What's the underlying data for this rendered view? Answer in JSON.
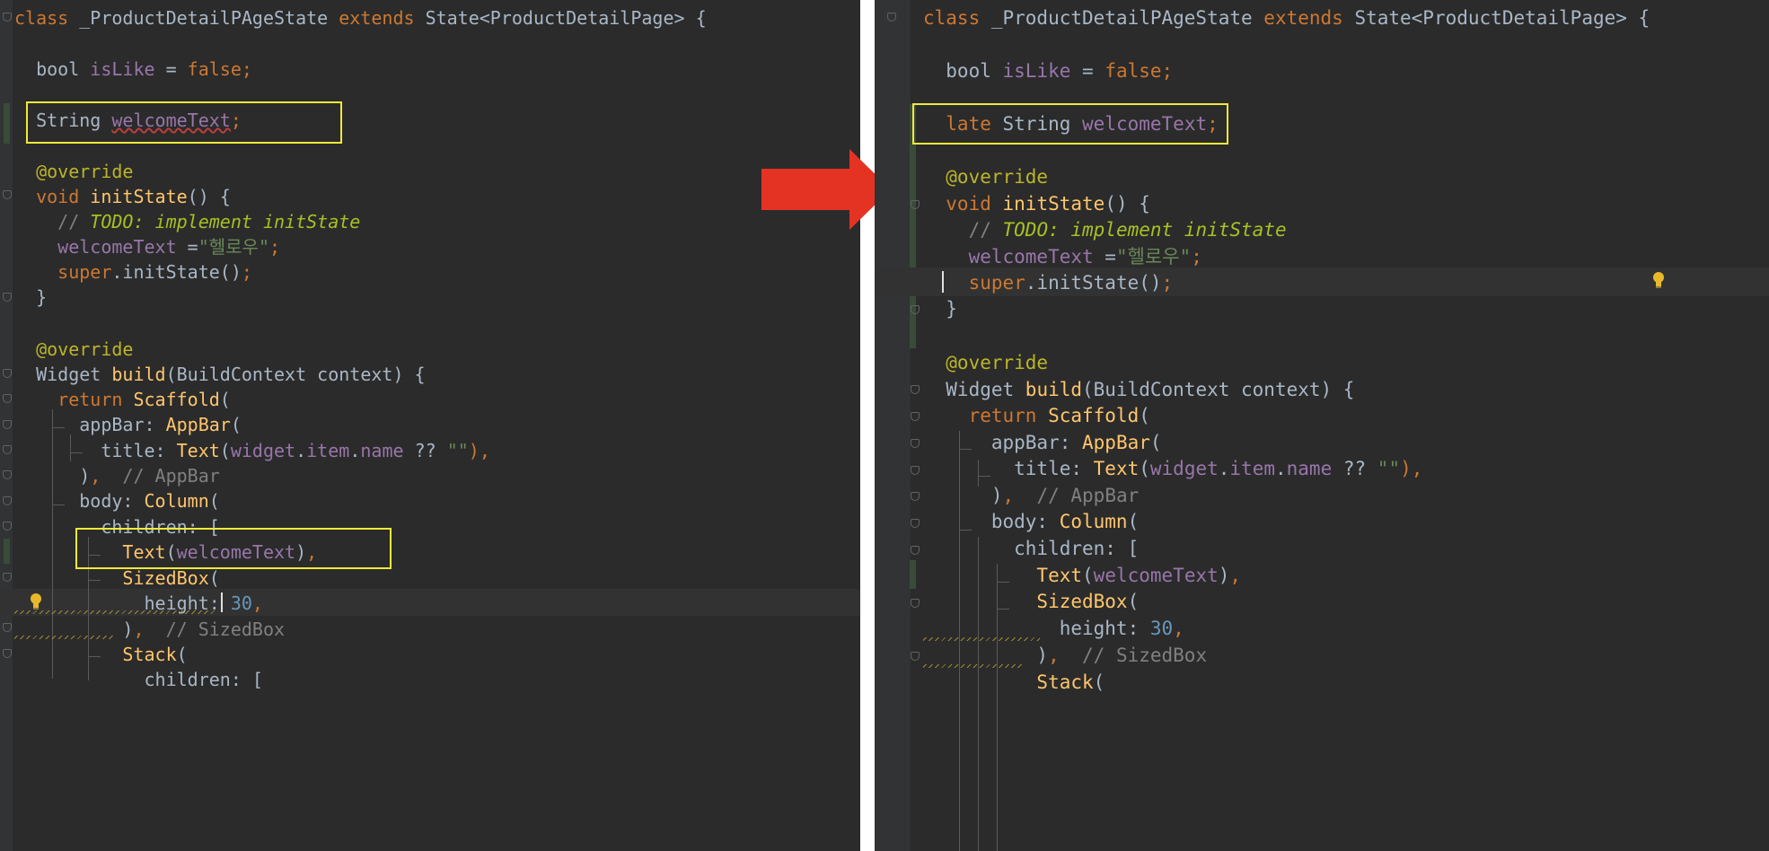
{
  "left": {
    "lines": [
      [
        {
          "t": "class ",
          "c": "kw"
        },
        {
          "t": "_ProductDetailPAgeState ",
          "c": "class"
        },
        {
          "t": "extends ",
          "c": "kw"
        },
        {
          "t": "State<ProductDetailPage> {",
          "c": ""
        }
      ],
      [
        {
          "t": "  bool ",
          "c": ""
        },
        {
          "t": "isLike",
          "c": "field"
        },
        {
          "t": " = ",
          "c": ""
        },
        {
          "t": "false",
          "c": "kw"
        },
        {
          "t": ";",
          "c": "kw"
        }
      ],
      [
        {
          "t": "  String ",
          "c": ""
        },
        {
          "t": "welcomeText",
          "c": "err"
        },
        {
          "t": ";",
          "c": "kw"
        }
      ],
      [
        {
          "t": "  @override",
          "c": "ann"
        }
      ],
      [
        {
          "t": "  void ",
          "c": "kw"
        },
        {
          "t": "initState",
          "c": "method"
        },
        {
          "t": "() {",
          "c": ""
        }
      ],
      [
        {
          "t": "    // ",
          "c": "comment"
        },
        {
          "t": "TODO: implement initState",
          "c": "todo"
        }
      ],
      [
        {
          "t": "    welcomeText",
          "c": "field"
        },
        {
          "t": " =",
          "c": ""
        },
        {
          "t": "\"헬로우\"",
          "c": "str"
        },
        {
          "t": ";",
          "c": "kw"
        }
      ],
      [
        {
          "t": "    super",
          "c": "kw"
        },
        {
          "t": ".initState()",
          "c": ""
        },
        {
          "t": ";",
          "c": "kw"
        }
      ],
      [
        {
          "t": "  }",
          "c": ""
        }
      ],
      [
        {
          "t": "  @override",
          "c": "ann"
        }
      ],
      [
        {
          "t": "  Widget ",
          "c": ""
        },
        {
          "t": "build",
          "c": "method"
        },
        {
          "t": "(BuildContext context) {",
          "c": ""
        }
      ],
      [
        {
          "t": "    return ",
          "c": "kw"
        },
        {
          "t": "Scaffold",
          "c": "method"
        },
        {
          "t": "(",
          "c": ""
        }
      ],
      [
        {
          "t": "      appBar: ",
          "c": ""
        },
        {
          "t": "AppBar",
          "c": "method"
        },
        {
          "t": "(",
          "c": ""
        }
      ],
      [
        {
          "t": "        title: ",
          "c": ""
        },
        {
          "t": "Text",
          "c": "method"
        },
        {
          "t": "(",
          "c": ""
        },
        {
          "t": "widget",
          "c": "field"
        },
        {
          "t": ".",
          "c": ""
        },
        {
          "t": "item",
          "c": "field"
        },
        {
          "t": ".",
          "c": ""
        },
        {
          "t": "name",
          "c": "field"
        },
        {
          "t": " ?? ",
          "c": ""
        },
        {
          "t": "\"\"",
          "c": "str"
        },
        {
          "t": "),",
          "c": "kw"
        }
      ],
      [
        {
          "t": "      )",
          "c": ""
        },
        {
          "t": ",",
          "c": "kw"
        },
        {
          "t": "  // AppBar",
          "c": "comment"
        }
      ],
      [
        {
          "t": "      body: ",
          "c": ""
        },
        {
          "t": "Column",
          "c": "method"
        },
        {
          "t": "(",
          "c": ""
        }
      ],
      [
        {
          "t": "        children: [",
          "c": ""
        }
      ],
      [
        {
          "t": "          Text",
          "c": "method"
        },
        {
          "t": "(",
          "c": ""
        },
        {
          "t": "welcomeText",
          "c": "field"
        },
        {
          "t": ")",
          "c": ""
        },
        {
          "t": ",",
          "c": "kw"
        }
      ],
      [
        {
          "t": "          SizedBox",
          "c": "method"
        },
        {
          "t": "(",
          "c": ""
        }
      ],
      [
        {
          "t": "            height: ",
          "c": ""
        },
        {
          "t": "30",
          "c": "num"
        },
        {
          "t": ",",
          "c": "kw"
        }
      ],
      [
        {
          "t": "          )",
          "c": ""
        },
        {
          "t": ",",
          "c": "kw"
        },
        {
          "t": "  // SizedBox",
          "c": "comment"
        }
      ],
      [
        {
          "t": "          Stack",
          "c": "method"
        },
        {
          "t": "(",
          "c": ""
        }
      ],
      [
        {
          "t": "            children: [",
          "c": ""
        }
      ]
    ]
  },
  "right": {
    "lines": [
      [
        {
          "t": "class ",
          "c": "kw"
        },
        {
          "t": "_ProductDetailPAgeState ",
          "c": "class"
        },
        {
          "t": "extends ",
          "c": "kw"
        },
        {
          "t": "State<ProductDetailPage> {",
          "c": ""
        }
      ],
      [
        {
          "t": "  bool ",
          "c": ""
        },
        {
          "t": "isLike",
          "c": "field"
        },
        {
          "t": " = ",
          "c": ""
        },
        {
          "t": "false",
          "c": "kw"
        },
        {
          "t": ";",
          "c": "kw"
        }
      ],
      [
        {
          "t": "  late ",
          "c": "kw"
        },
        {
          "t": "String ",
          "c": ""
        },
        {
          "t": "welcomeText",
          "c": "field"
        },
        {
          "t": ";",
          "c": "kw"
        }
      ],
      [
        {
          "t": "  @override",
          "c": "ann"
        }
      ],
      [
        {
          "t": "  void ",
          "c": "kw"
        },
        {
          "t": "initState",
          "c": "method"
        },
        {
          "t": "() {",
          "c": ""
        }
      ],
      [
        {
          "t": "    // ",
          "c": "comment"
        },
        {
          "t": "TODO: implement initState",
          "c": "todo"
        }
      ],
      [
        {
          "t": "    welcomeText",
          "c": "field"
        },
        {
          "t": " =",
          "c": ""
        },
        {
          "t": "\"헬로우\"",
          "c": "str"
        },
        {
          "t": ";",
          "c": "kw"
        }
      ],
      [
        {
          "t": "    super",
          "c": "kw"
        },
        {
          "t": ".initState()",
          "c": ""
        },
        {
          "t": ";",
          "c": "kw"
        }
      ],
      [
        {
          "t": "  }",
          "c": ""
        }
      ],
      [
        {
          "t": "  @override",
          "c": "ann"
        }
      ],
      [
        {
          "t": "  Widget ",
          "c": ""
        },
        {
          "t": "build",
          "c": "method"
        },
        {
          "t": "(BuildContext context) {",
          "c": ""
        }
      ],
      [
        {
          "t": "    return ",
          "c": "kw"
        },
        {
          "t": "Scaffold",
          "c": "method"
        },
        {
          "t": "(",
          "c": ""
        }
      ],
      [
        {
          "t": "      appBar: ",
          "c": ""
        },
        {
          "t": "AppBar",
          "c": "method"
        },
        {
          "t": "(",
          "c": ""
        }
      ],
      [
        {
          "t": "        title: ",
          "c": ""
        },
        {
          "t": "Text",
          "c": "method"
        },
        {
          "t": "(",
          "c": ""
        },
        {
          "t": "widget",
          "c": "field"
        },
        {
          "t": ".",
          "c": ""
        },
        {
          "t": "item",
          "c": "field"
        },
        {
          "t": ".",
          "c": ""
        },
        {
          "t": "name",
          "c": "field"
        },
        {
          "t": " ?? ",
          "c": ""
        },
        {
          "t": "\"\"",
          "c": "str"
        },
        {
          "t": "),",
          "c": "kw"
        }
      ],
      [
        {
          "t": "      )",
          "c": ""
        },
        {
          "t": ",",
          "c": "kw"
        },
        {
          "t": "  // AppBar",
          "c": "comment"
        }
      ],
      [
        {
          "t": "      body: ",
          "c": ""
        },
        {
          "t": "Column",
          "c": "method"
        },
        {
          "t": "(",
          "c": ""
        }
      ],
      [
        {
          "t": "        children: [",
          "c": ""
        }
      ],
      [
        {
          "t": "          Text",
          "c": "method"
        },
        {
          "t": "(",
          "c": ""
        },
        {
          "t": "welcomeText",
          "c": "field"
        },
        {
          "t": ")",
          "c": ""
        },
        {
          "t": ",",
          "c": "kw"
        }
      ],
      [
        {
          "t": "          SizedBox",
          "c": "method"
        },
        {
          "t": "(",
          "c": ""
        }
      ],
      [
        {
          "t": "            height: ",
          "c": ""
        },
        {
          "t": "30",
          "c": "num"
        },
        {
          "t": ",",
          "c": "kw"
        }
      ],
      [
        {
          "t": "          )",
          "c": ""
        },
        {
          "t": ",",
          "c": "kw"
        },
        {
          "t": "  // SizedBox",
          "c": "comment"
        }
      ],
      [
        {
          "t": "          Stack",
          "c": "method"
        },
        {
          "t": "(",
          "c": ""
        }
      ]
    ]
  },
  "colors": {
    "editor_bg": "#2b2b2b",
    "highlight_box": "#f0ea3a",
    "arrow": "#e53323"
  },
  "icons": [
    "arrow-right-icon",
    "lightbulb-icon",
    "fold-icon"
  ]
}
